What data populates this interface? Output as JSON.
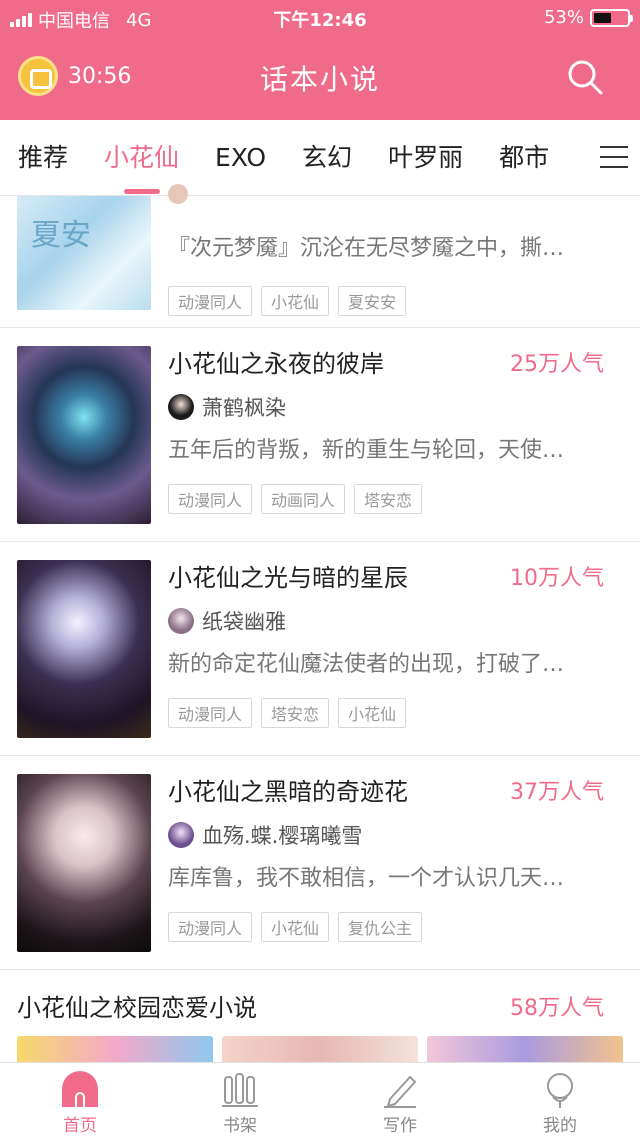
{
  "status_bar": {
    "carrier": "中国电信",
    "network": "4G",
    "time": "下午12:46",
    "battery": "53%",
    "battery_level": 0.53
  },
  "header": {
    "timer": "30:56",
    "title": "话本小说",
    "search_icon": "search-icon",
    "timer_icon": "coin-clock-icon"
  },
  "tabs": [
    "推荐",
    "小花仙",
    "EXO",
    "玄幻",
    "叶罗丽",
    "都市"
  ],
  "active_tab": "小花仙",
  "partial_book": {
    "desc": "『次元梦魇』沉沦在无尽梦魇之中，撕…",
    "tags": [
      "动漫同人",
      "小花仙",
      "夏安安"
    ],
    "cover_text": "夏安"
  },
  "books": [
    {
      "title": "小花仙之永夜的彼岸",
      "popularity": "25万人气",
      "author": "萧鹤枫染",
      "desc": "五年后的背叛，新的重生与轮回，天使…",
      "tags": [
        "动漫同人",
        "动画同人",
        "塔安恋"
      ]
    },
    {
      "title": "小花仙之光与暗的星辰",
      "popularity": "10万人气",
      "author": "纸袋幽雅",
      "desc": "新的命定花仙魔法使者的出现，打破了…",
      "tags": [
        "动漫同人",
        "塔安恋",
        "小花仙"
      ]
    },
    {
      "title": "小花仙之黑暗的奇迹花",
      "popularity": "37万人气",
      "author": "血殇.蝶.樱璃曦雪",
      "desc": "库库鲁，我不敢相信，一个才认识几天…",
      "tags": [
        "动漫同人",
        "小花仙",
        "复仇公主"
      ]
    }
  ],
  "section": {
    "title": "小花仙之校园恋爱小说",
    "popularity": "58万人气"
  },
  "bottom_nav": [
    {
      "label": "首页",
      "icon": "home-icon"
    },
    {
      "label": "书架",
      "icon": "bookshelf-icon"
    },
    {
      "label": "写作",
      "icon": "pen-icon"
    },
    {
      "label": "我的",
      "icon": "profile-icon"
    }
  ],
  "colors": {
    "accent": "#f06b8a"
  }
}
